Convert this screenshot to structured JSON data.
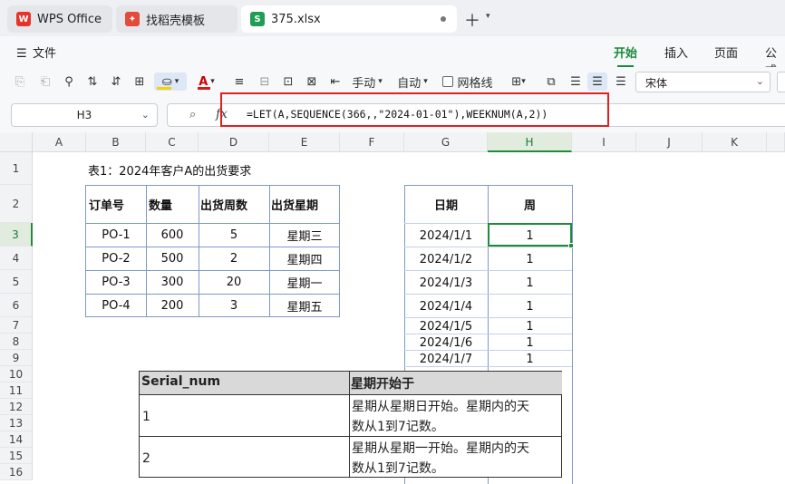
{
  "tabs": {
    "wps": "WPS Office",
    "template": "找稻壳模板",
    "file": "375.xlsx",
    "file_icon": "S"
  },
  "menu": {
    "file": "文件",
    "ribbon_tabs": [
      "开始",
      "插入",
      "页面",
      "公式"
    ],
    "active_tab": "开始"
  },
  "toolbar": {
    "horizontal": "手动",
    "auto": "自动",
    "gridlines": "网格线",
    "font_name": "宋体",
    "colors": {
      "fill": "#f2d30b",
      "font": "#d21c1c",
      "accent": "#1a8a3a"
    }
  },
  "formula_bar": {
    "cell_ref": "H3",
    "fx": "fx",
    "formula": "=LET(A,SEQUENCE(366,,\"2024-01-01\"),WEEKNUM(A,2))"
  },
  "grid": {
    "columns": [
      "A",
      "B",
      "C",
      "D",
      "E",
      "F",
      "G",
      "H",
      "I",
      "J",
      "K"
    ],
    "rows": [
      "1",
      "2",
      "3",
      "4",
      "5",
      "6",
      "7",
      "8",
      "9",
      "10",
      "11",
      "12",
      "13",
      "14",
      "15",
      "16"
    ],
    "selected_column": "H",
    "selected_row": "3"
  },
  "sheet": {
    "title": "表1：2024年客户A的出货要求",
    "table1": {
      "headers": [
        "订单号",
        "数量",
        "出货周数",
        "出货星期"
      ],
      "rows": [
        [
          "PO-1",
          "600",
          "5",
          "星期三"
        ],
        [
          "PO-2",
          "500",
          "2",
          "星期四"
        ],
        [
          "PO-3",
          "300",
          "20",
          "星期一"
        ],
        [
          "PO-4",
          "200",
          "3",
          "星期五"
        ]
      ]
    },
    "table2": {
      "headers": [
        "日期",
        "周"
      ],
      "rows": [
        [
          "2024/1/1",
          "1"
        ],
        [
          "2024/1/2",
          "1"
        ],
        [
          "2024/1/3",
          "1"
        ],
        [
          "2024/1/4",
          "1"
        ],
        [
          "2024/1/5",
          "1"
        ],
        [
          "2024/1/6",
          "1"
        ],
        [
          "2024/1/7",
          "1"
        ]
      ]
    }
  },
  "help_table": {
    "headers": [
      "Serial_num",
      "星期开始于"
    ],
    "rows": [
      [
        "1",
        "星期从星期日开始。星期内的天",
        "数从1到7记数。"
      ],
      [
        "2",
        "星期从星期一开始。星期内的天",
        "数从1到7记数。"
      ]
    ]
  }
}
